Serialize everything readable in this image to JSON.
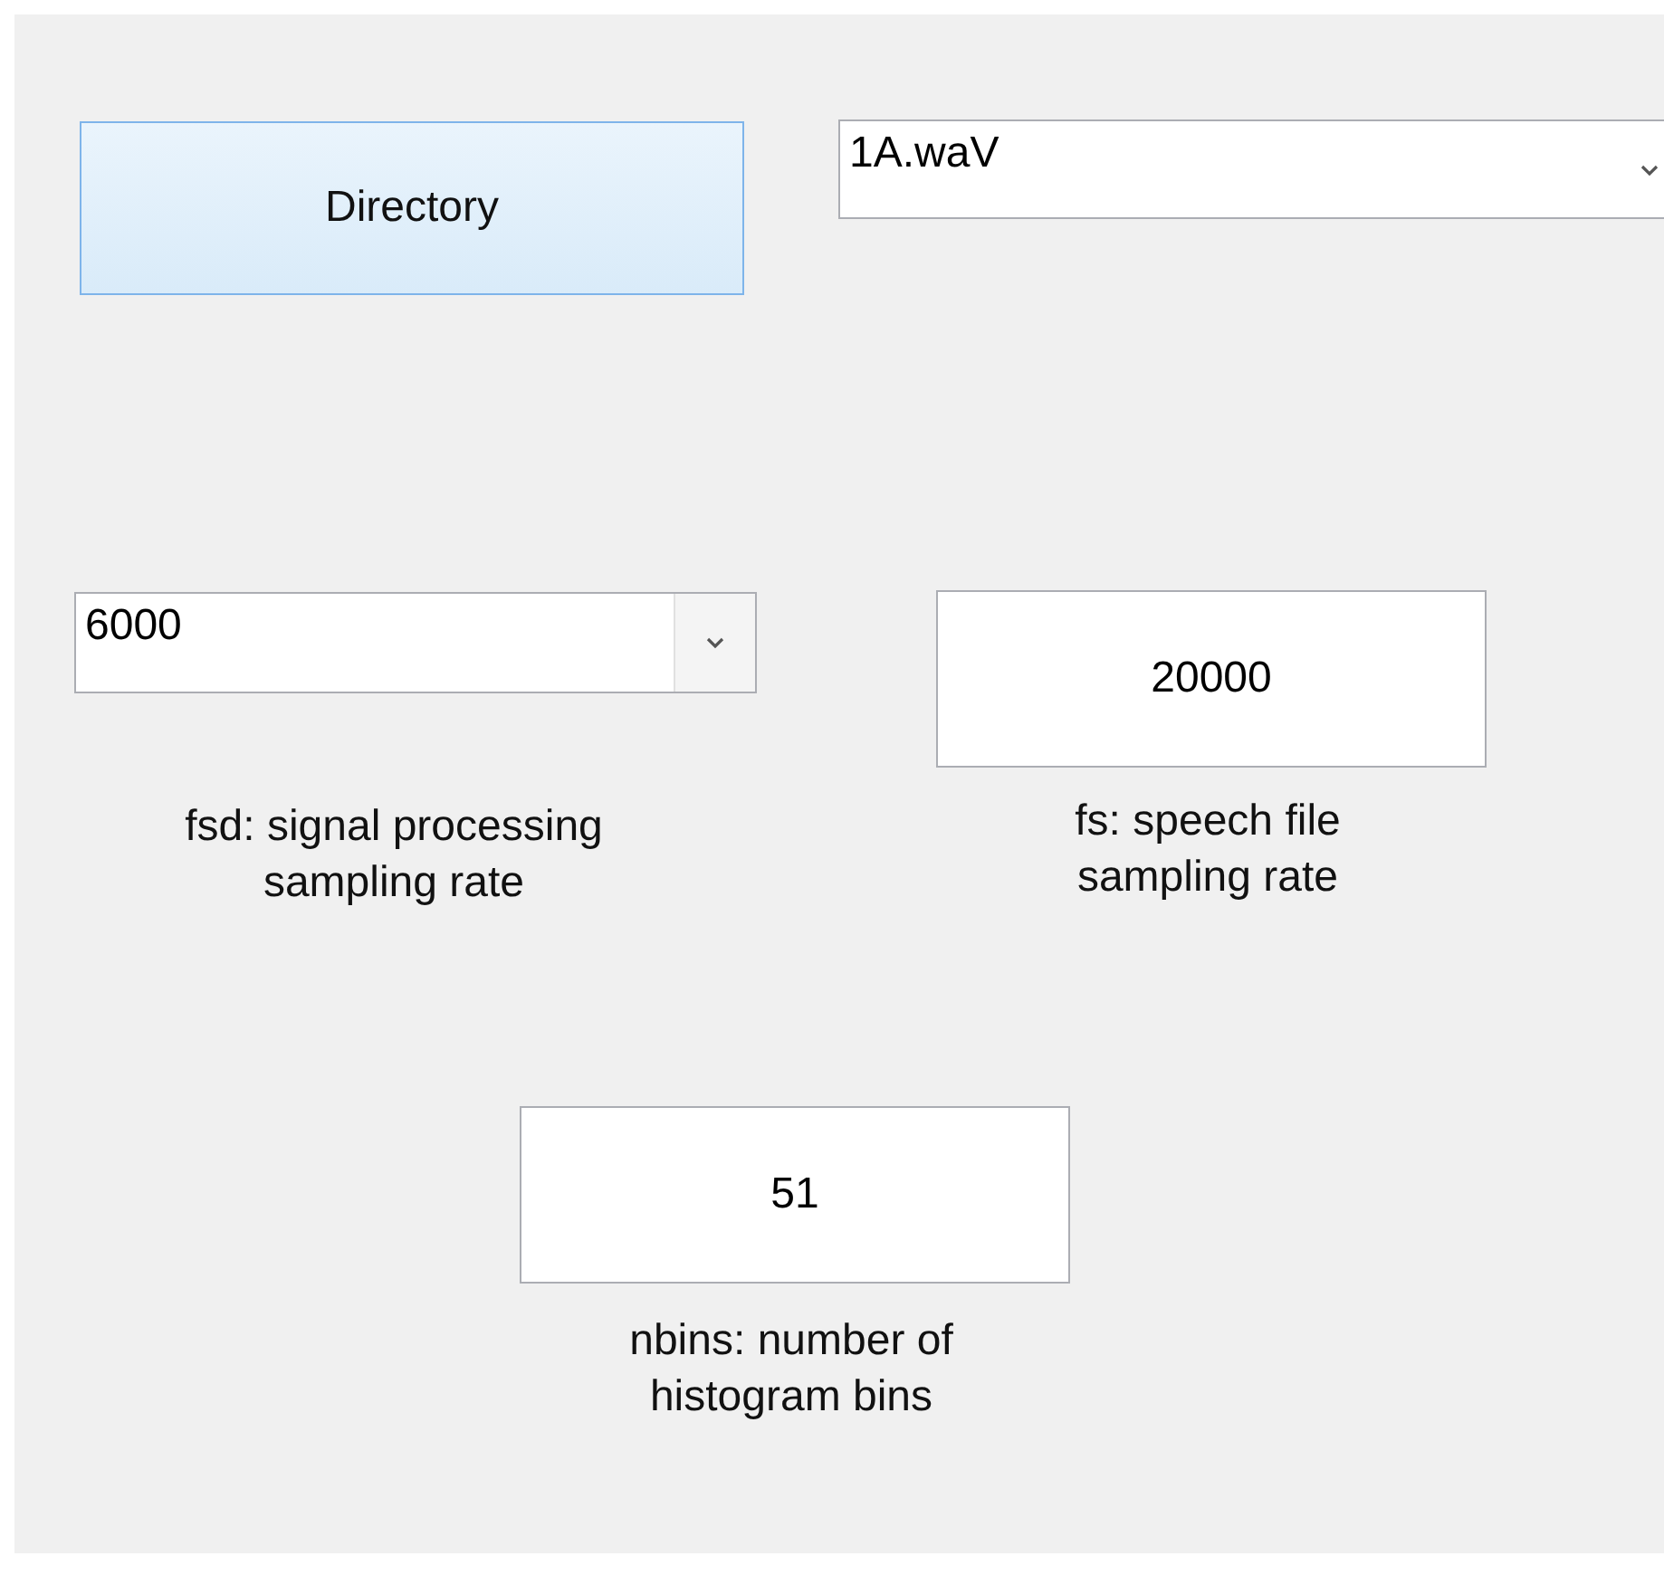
{
  "directory_button": {
    "label": "Directory"
  },
  "file_dropdown": {
    "value": "1A.waV"
  },
  "fields": [
    {
      "kind": "dropdown",
      "value": "6000",
      "label": "fsd: signal processing\nsampling rate"
    },
    {
      "kind": "textbox",
      "value": "20000",
      "label": "fs: speech file\nsampling rate"
    },
    {
      "kind": "textbox",
      "value": "51",
      "label": "nbins: number of\nhistogram bins"
    }
  ]
}
